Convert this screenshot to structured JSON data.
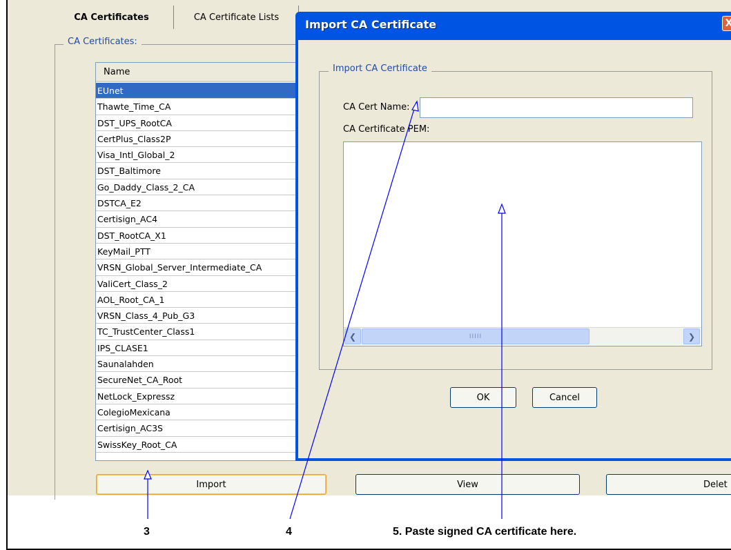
{
  "tabs": [
    {
      "label": "CA Certificates",
      "active": true
    },
    {
      "label": "CA Certificate Lists",
      "active": false
    }
  ],
  "group": {
    "legend": "CA Certificates:"
  },
  "list": {
    "header": "Name",
    "selected_index": 0,
    "items": [
      "EUnet",
      "Thawte_Time_CA",
      "DST_UPS_RootCA",
      "CertPlus_Class2P",
      "Visa_Intl_Global_2",
      "DST_Baltimore",
      "Go_Daddy_Class_2_CA",
      "DSTCA_E2",
      "Certisign_AC4",
      "DST_RootCA_X1",
      "KeyMail_PTT",
      "VRSN_Global_Server_Intermediate_CA",
      "ValiCert_Class_2",
      "AOL_Root_CA_1",
      "VRSN_Class_4_Pub_G3",
      "TC_TrustCenter_Class1",
      "IPS_CLASE1",
      "Saunalahden",
      "SecureNet_CA_Root",
      "NetLock_Expressz",
      "ColegioMexicana",
      "Certisign_AC3S",
      "SwissKey_Root_CA"
    ]
  },
  "buttons": {
    "import": "Import",
    "view": "View",
    "delete": "Delet"
  },
  "dialog": {
    "title": "Import CA Certificate",
    "legend": "Import CA Certificate",
    "cert_name_label": "CA Cert Name:",
    "cert_name_value": "",
    "pem_label": "CA Certificate PEM:",
    "ok": "OK",
    "cancel": "Cancel",
    "close_glyph": "X",
    "scroll_grip": "IIIII"
  },
  "callouts": {
    "c3": "3",
    "c4": "4",
    "c5": "5. Paste signed CA certificate here."
  },
  "colors": {
    "callout_line": "#0000ff",
    "title_bar": "#0054e3",
    "selection": "#316ac5"
  }
}
